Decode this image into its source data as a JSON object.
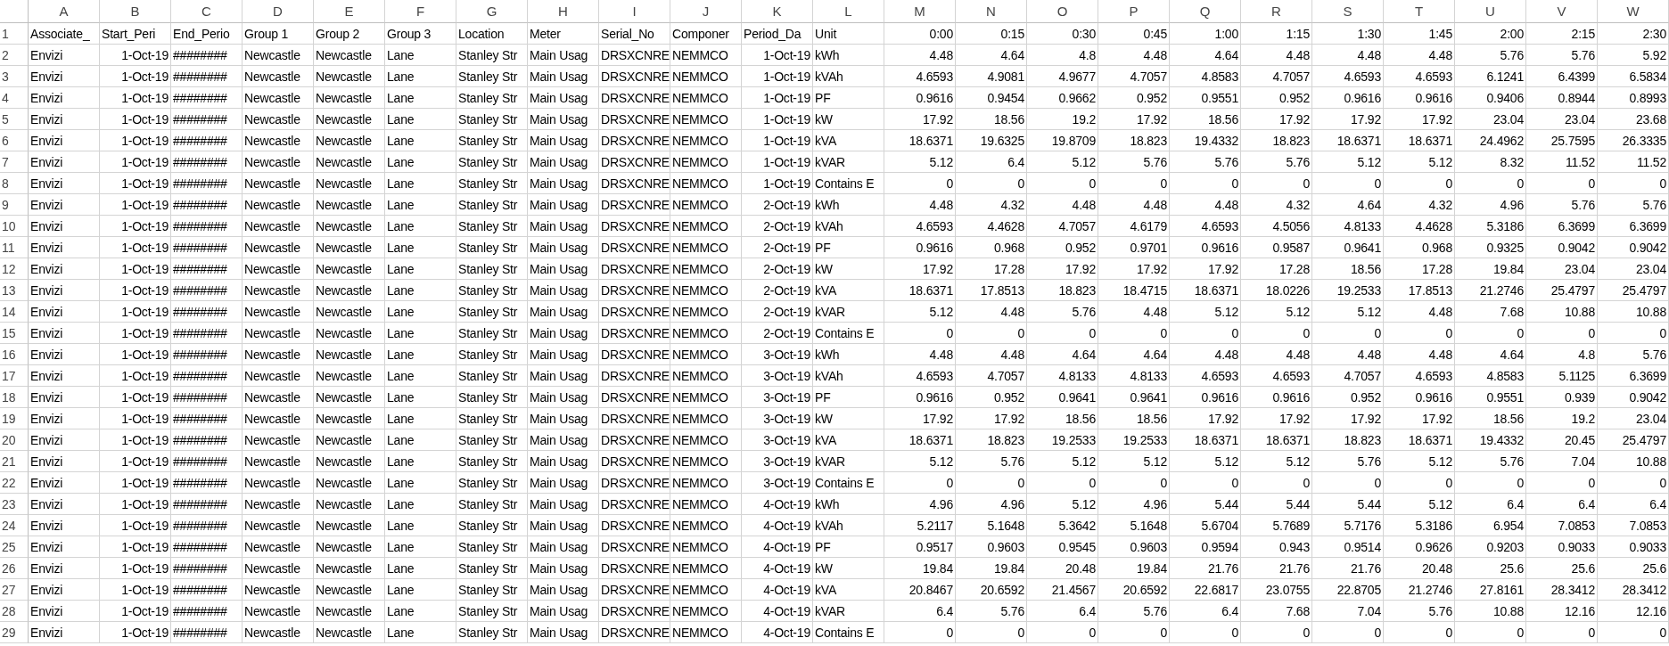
{
  "header_row_number": "1",
  "columns": [
    {
      "letter": "A",
      "header": "Associate_",
      "kind": "text"
    },
    {
      "letter": "B",
      "header": "Start_Peri",
      "kind": "date"
    },
    {
      "letter": "C",
      "header": "End_Perio",
      "kind": "text"
    },
    {
      "letter": "D",
      "header": "Group 1",
      "kind": "text"
    },
    {
      "letter": "E",
      "header": "Group 2",
      "kind": "text"
    },
    {
      "letter": "F",
      "header": "Group 3",
      "kind": "text"
    },
    {
      "letter": "G",
      "header": "Location",
      "kind": "text"
    },
    {
      "letter": "H",
      "header": "Meter",
      "kind": "text"
    },
    {
      "letter": "I",
      "header": "Serial_No",
      "kind": "text"
    },
    {
      "letter": "J",
      "header": "Componer",
      "kind": "text"
    },
    {
      "letter": "K",
      "header": "Period_Da",
      "kind": "date"
    },
    {
      "letter": "L",
      "header": "Unit",
      "kind": "text"
    },
    {
      "letter": "M",
      "header": "0:00",
      "kind": "value"
    },
    {
      "letter": "N",
      "header": "0:15",
      "kind": "value"
    },
    {
      "letter": "O",
      "header": "0:30",
      "kind": "value"
    },
    {
      "letter": "P",
      "header": "0:45",
      "kind": "value"
    },
    {
      "letter": "Q",
      "header": "1:00",
      "kind": "value"
    },
    {
      "letter": "R",
      "header": "1:15",
      "kind": "value"
    },
    {
      "letter": "S",
      "header": "1:30",
      "kind": "value"
    },
    {
      "letter": "T",
      "header": "1:45",
      "kind": "value"
    },
    {
      "letter": "U",
      "header": "2:00",
      "kind": "value"
    },
    {
      "letter": "V",
      "header": "2:15",
      "kind": "value"
    },
    {
      "letter": "W",
      "header": "2:30",
      "kind": "value"
    }
  ],
  "rows": [
    {
      "number": "2",
      "cells": [
        "Envizi",
        "1-Oct-19",
        "########",
        "Newcastle",
        "Newcastle",
        "Lane",
        "Stanley Str",
        "Main Usag",
        "DRSXCNRE",
        "NEMMCO",
        "1-Oct-19",
        "kWh",
        "4.48",
        "4.64",
        "4.8",
        "4.48",
        "4.64",
        "4.48",
        "4.48",
        "4.48",
        "5.76",
        "5.76",
        "5.92"
      ]
    },
    {
      "number": "3",
      "cells": [
        "Envizi",
        "1-Oct-19",
        "########",
        "Newcastle",
        "Newcastle",
        "Lane",
        "Stanley Str",
        "Main Usag",
        "DRSXCNRE",
        "NEMMCO",
        "1-Oct-19",
        "kVAh",
        "4.6593",
        "4.9081",
        "4.9677",
        "4.7057",
        "4.8583",
        "4.7057",
        "4.6593",
        "4.6593",
        "6.1241",
        "6.4399",
        "6.5834"
      ]
    },
    {
      "number": "4",
      "cells": [
        "Envizi",
        "1-Oct-19",
        "########",
        "Newcastle",
        "Newcastle",
        "Lane",
        "Stanley Str",
        "Main Usag",
        "DRSXCNRE",
        "NEMMCO",
        "1-Oct-19",
        "PF",
        "0.9616",
        "0.9454",
        "0.9662",
        "0.952",
        "0.9551",
        "0.952",
        "0.9616",
        "0.9616",
        "0.9406",
        "0.8944",
        "0.8993"
      ]
    },
    {
      "number": "5",
      "cells": [
        "Envizi",
        "1-Oct-19",
        "########",
        "Newcastle",
        "Newcastle",
        "Lane",
        "Stanley Str",
        "Main Usag",
        "DRSXCNRE",
        "NEMMCO",
        "1-Oct-19",
        "kW",
        "17.92",
        "18.56",
        "19.2",
        "17.92",
        "18.56",
        "17.92",
        "17.92",
        "17.92",
        "23.04",
        "23.04",
        "23.68"
      ]
    },
    {
      "number": "6",
      "cells": [
        "Envizi",
        "1-Oct-19",
        "########",
        "Newcastle",
        "Newcastle",
        "Lane",
        "Stanley Str",
        "Main Usag",
        "DRSXCNRE",
        "NEMMCO",
        "1-Oct-19",
        "kVA",
        "18.6371",
        "19.6325",
        "19.8709",
        "18.823",
        "19.4332",
        "18.823",
        "18.6371",
        "18.6371",
        "24.4962",
        "25.7595",
        "26.3335"
      ]
    },
    {
      "number": "7",
      "cells": [
        "Envizi",
        "1-Oct-19",
        "########",
        "Newcastle",
        "Newcastle",
        "Lane",
        "Stanley Str",
        "Main Usag",
        "DRSXCNRE",
        "NEMMCO",
        "1-Oct-19",
        "kVAR",
        "5.12",
        "6.4",
        "5.12",
        "5.76",
        "5.76",
        "5.76",
        "5.12",
        "5.12",
        "8.32",
        "11.52",
        "11.52"
      ]
    },
    {
      "number": "8",
      "cells": [
        "Envizi",
        "1-Oct-19",
        "########",
        "Newcastle",
        "Newcastle",
        "Lane",
        "Stanley Str",
        "Main Usag",
        "DRSXCNRE",
        "NEMMCO",
        "1-Oct-19",
        "Contains E",
        "0",
        "0",
        "0",
        "0",
        "0",
        "0",
        "0",
        "0",
        "0",
        "0",
        "0"
      ]
    },
    {
      "number": "9",
      "cells": [
        "Envizi",
        "1-Oct-19",
        "########",
        "Newcastle",
        "Newcastle",
        "Lane",
        "Stanley Str",
        "Main Usag",
        "DRSXCNRE",
        "NEMMCO",
        "2-Oct-19",
        "kWh",
        "4.48",
        "4.32",
        "4.48",
        "4.48",
        "4.48",
        "4.32",
        "4.64",
        "4.32",
        "4.96",
        "5.76",
        "5.76"
      ]
    },
    {
      "number": "10",
      "cells": [
        "Envizi",
        "1-Oct-19",
        "########",
        "Newcastle",
        "Newcastle",
        "Lane",
        "Stanley Str",
        "Main Usag",
        "DRSXCNRE",
        "NEMMCO",
        "2-Oct-19",
        "kVAh",
        "4.6593",
        "4.4628",
        "4.7057",
        "4.6179",
        "4.6593",
        "4.5056",
        "4.8133",
        "4.4628",
        "5.3186",
        "6.3699",
        "6.3699"
      ]
    },
    {
      "number": "11",
      "cells": [
        "Envizi",
        "1-Oct-19",
        "########",
        "Newcastle",
        "Newcastle",
        "Lane",
        "Stanley Str",
        "Main Usag",
        "DRSXCNRE",
        "NEMMCO",
        "2-Oct-19",
        "PF",
        "0.9616",
        "0.968",
        "0.952",
        "0.9701",
        "0.9616",
        "0.9587",
        "0.9641",
        "0.968",
        "0.9325",
        "0.9042",
        "0.9042"
      ]
    },
    {
      "number": "12",
      "cells": [
        "Envizi",
        "1-Oct-19",
        "########",
        "Newcastle",
        "Newcastle",
        "Lane",
        "Stanley Str",
        "Main Usag",
        "DRSXCNRE",
        "NEMMCO",
        "2-Oct-19",
        "kW",
        "17.92",
        "17.28",
        "17.92",
        "17.92",
        "17.92",
        "17.28",
        "18.56",
        "17.28",
        "19.84",
        "23.04",
        "23.04"
      ]
    },
    {
      "number": "13",
      "cells": [
        "Envizi",
        "1-Oct-19",
        "########",
        "Newcastle",
        "Newcastle",
        "Lane",
        "Stanley Str",
        "Main Usag",
        "DRSXCNRE",
        "NEMMCO",
        "2-Oct-19",
        "kVA",
        "18.6371",
        "17.8513",
        "18.823",
        "18.4715",
        "18.6371",
        "18.0226",
        "19.2533",
        "17.8513",
        "21.2746",
        "25.4797",
        "25.4797"
      ]
    },
    {
      "number": "14",
      "cells": [
        "Envizi",
        "1-Oct-19",
        "########",
        "Newcastle",
        "Newcastle",
        "Lane",
        "Stanley Str",
        "Main Usag",
        "DRSXCNRE",
        "NEMMCO",
        "2-Oct-19",
        "kVAR",
        "5.12",
        "4.48",
        "5.76",
        "4.48",
        "5.12",
        "5.12",
        "5.12",
        "4.48",
        "7.68",
        "10.88",
        "10.88"
      ]
    },
    {
      "number": "15",
      "cells": [
        "Envizi",
        "1-Oct-19",
        "########",
        "Newcastle",
        "Newcastle",
        "Lane",
        "Stanley Str",
        "Main Usag",
        "DRSXCNRE",
        "NEMMCO",
        "2-Oct-19",
        "Contains E",
        "0",
        "0",
        "0",
        "0",
        "0",
        "0",
        "0",
        "0",
        "0",
        "0",
        "0"
      ]
    },
    {
      "number": "16",
      "cells": [
        "Envizi",
        "1-Oct-19",
        "########",
        "Newcastle",
        "Newcastle",
        "Lane",
        "Stanley Str",
        "Main Usag",
        "DRSXCNRE",
        "NEMMCO",
        "3-Oct-19",
        "kWh",
        "4.48",
        "4.48",
        "4.64",
        "4.64",
        "4.48",
        "4.48",
        "4.48",
        "4.48",
        "4.64",
        "4.8",
        "5.76"
      ]
    },
    {
      "number": "17",
      "cells": [
        "Envizi",
        "1-Oct-19",
        "########",
        "Newcastle",
        "Newcastle",
        "Lane",
        "Stanley Str",
        "Main Usag",
        "DRSXCNRE",
        "NEMMCO",
        "3-Oct-19",
        "kVAh",
        "4.6593",
        "4.7057",
        "4.8133",
        "4.8133",
        "4.6593",
        "4.6593",
        "4.7057",
        "4.6593",
        "4.8583",
        "5.1125",
        "6.3699"
      ]
    },
    {
      "number": "18",
      "cells": [
        "Envizi",
        "1-Oct-19",
        "########",
        "Newcastle",
        "Newcastle",
        "Lane",
        "Stanley Str",
        "Main Usag",
        "DRSXCNRE",
        "NEMMCO",
        "3-Oct-19",
        "PF",
        "0.9616",
        "0.952",
        "0.9641",
        "0.9641",
        "0.9616",
        "0.9616",
        "0.952",
        "0.9616",
        "0.9551",
        "0.939",
        "0.9042"
      ]
    },
    {
      "number": "19",
      "cells": [
        "Envizi",
        "1-Oct-19",
        "########",
        "Newcastle",
        "Newcastle",
        "Lane",
        "Stanley Str",
        "Main Usag",
        "DRSXCNRE",
        "NEMMCO",
        "3-Oct-19",
        "kW",
        "17.92",
        "17.92",
        "18.56",
        "18.56",
        "17.92",
        "17.92",
        "17.92",
        "17.92",
        "18.56",
        "19.2",
        "23.04"
      ]
    },
    {
      "number": "20",
      "cells": [
        "Envizi",
        "1-Oct-19",
        "########",
        "Newcastle",
        "Newcastle",
        "Lane",
        "Stanley Str",
        "Main Usag",
        "DRSXCNRE",
        "NEMMCO",
        "3-Oct-19",
        "kVA",
        "18.6371",
        "18.823",
        "19.2533",
        "19.2533",
        "18.6371",
        "18.6371",
        "18.823",
        "18.6371",
        "19.4332",
        "20.45",
        "25.4797"
      ]
    },
    {
      "number": "21",
      "cells": [
        "Envizi",
        "1-Oct-19",
        "########",
        "Newcastle",
        "Newcastle",
        "Lane",
        "Stanley Str",
        "Main Usag",
        "DRSXCNRE",
        "NEMMCO",
        "3-Oct-19",
        "kVAR",
        "5.12",
        "5.76",
        "5.12",
        "5.12",
        "5.12",
        "5.12",
        "5.76",
        "5.12",
        "5.76",
        "7.04",
        "10.88"
      ]
    },
    {
      "number": "22",
      "cells": [
        "Envizi",
        "1-Oct-19",
        "########",
        "Newcastle",
        "Newcastle",
        "Lane",
        "Stanley Str",
        "Main Usag",
        "DRSXCNRE",
        "NEMMCO",
        "3-Oct-19",
        "Contains E",
        "0",
        "0",
        "0",
        "0",
        "0",
        "0",
        "0",
        "0",
        "0",
        "0",
        "0"
      ]
    },
    {
      "number": "23",
      "cells": [
        "Envizi",
        "1-Oct-19",
        "########",
        "Newcastle",
        "Newcastle",
        "Lane",
        "Stanley Str",
        "Main Usag",
        "DRSXCNRE",
        "NEMMCO",
        "4-Oct-19",
        "kWh",
        "4.96",
        "4.96",
        "5.12",
        "4.96",
        "5.44",
        "5.44",
        "5.44",
        "5.12",
        "6.4",
        "6.4",
        "6.4"
      ]
    },
    {
      "number": "24",
      "cells": [
        "Envizi",
        "1-Oct-19",
        "########",
        "Newcastle",
        "Newcastle",
        "Lane",
        "Stanley Str",
        "Main Usag",
        "DRSXCNRE",
        "NEMMCO",
        "4-Oct-19",
        "kVAh",
        "5.2117",
        "5.1648",
        "5.3642",
        "5.1648",
        "5.6704",
        "5.7689",
        "5.7176",
        "5.3186",
        "6.954",
        "7.0853",
        "7.0853"
      ]
    },
    {
      "number": "25",
      "cells": [
        "Envizi",
        "1-Oct-19",
        "########",
        "Newcastle",
        "Newcastle",
        "Lane",
        "Stanley Str",
        "Main Usag",
        "DRSXCNRE",
        "NEMMCO",
        "4-Oct-19",
        "PF",
        "0.9517",
        "0.9603",
        "0.9545",
        "0.9603",
        "0.9594",
        "0.943",
        "0.9514",
        "0.9626",
        "0.9203",
        "0.9033",
        "0.9033"
      ]
    },
    {
      "number": "26",
      "cells": [
        "Envizi",
        "1-Oct-19",
        "########",
        "Newcastle",
        "Newcastle",
        "Lane",
        "Stanley Str",
        "Main Usag",
        "DRSXCNRE",
        "NEMMCO",
        "4-Oct-19",
        "kW",
        "19.84",
        "19.84",
        "20.48",
        "19.84",
        "21.76",
        "21.76",
        "21.76",
        "20.48",
        "25.6",
        "25.6",
        "25.6"
      ]
    },
    {
      "number": "27",
      "cells": [
        "Envizi",
        "1-Oct-19",
        "########",
        "Newcastle",
        "Newcastle",
        "Lane",
        "Stanley Str",
        "Main Usag",
        "DRSXCNRE",
        "NEMMCO",
        "4-Oct-19",
        "kVA",
        "20.8467",
        "20.6592",
        "21.4567",
        "20.6592",
        "22.6817",
        "23.0755",
        "22.8705",
        "21.2746",
        "27.8161",
        "28.3412",
        "28.3412"
      ]
    },
    {
      "number": "28",
      "cells": [
        "Envizi",
        "1-Oct-19",
        "########",
        "Newcastle",
        "Newcastle",
        "Lane",
        "Stanley Str",
        "Main Usag",
        "DRSXCNRE",
        "NEMMCO",
        "4-Oct-19",
        "kVAR",
        "6.4",
        "5.76",
        "6.4",
        "5.76",
        "6.4",
        "7.68",
        "7.04",
        "5.76",
        "10.88",
        "12.16",
        "12.16"
      ]
    },
    {
      "number": "29",
      "cells": [
        "Envizi",
        "1-Oct-19",
        "########",
        "Newcastle",
        "Newcastle",
        "Lane",
        "Stanley Str",
        "Main Usag",
        "DRSXCNRE",
        "NEMMCO",
        "4-Oct-19",
        "Contains E",
        "0",
        "0",
        "0",
        "0",
        "0",
        "0",
        "0",
        "0",
        "0",
        "0",
        "0"
      ]
    }
  ]
}
